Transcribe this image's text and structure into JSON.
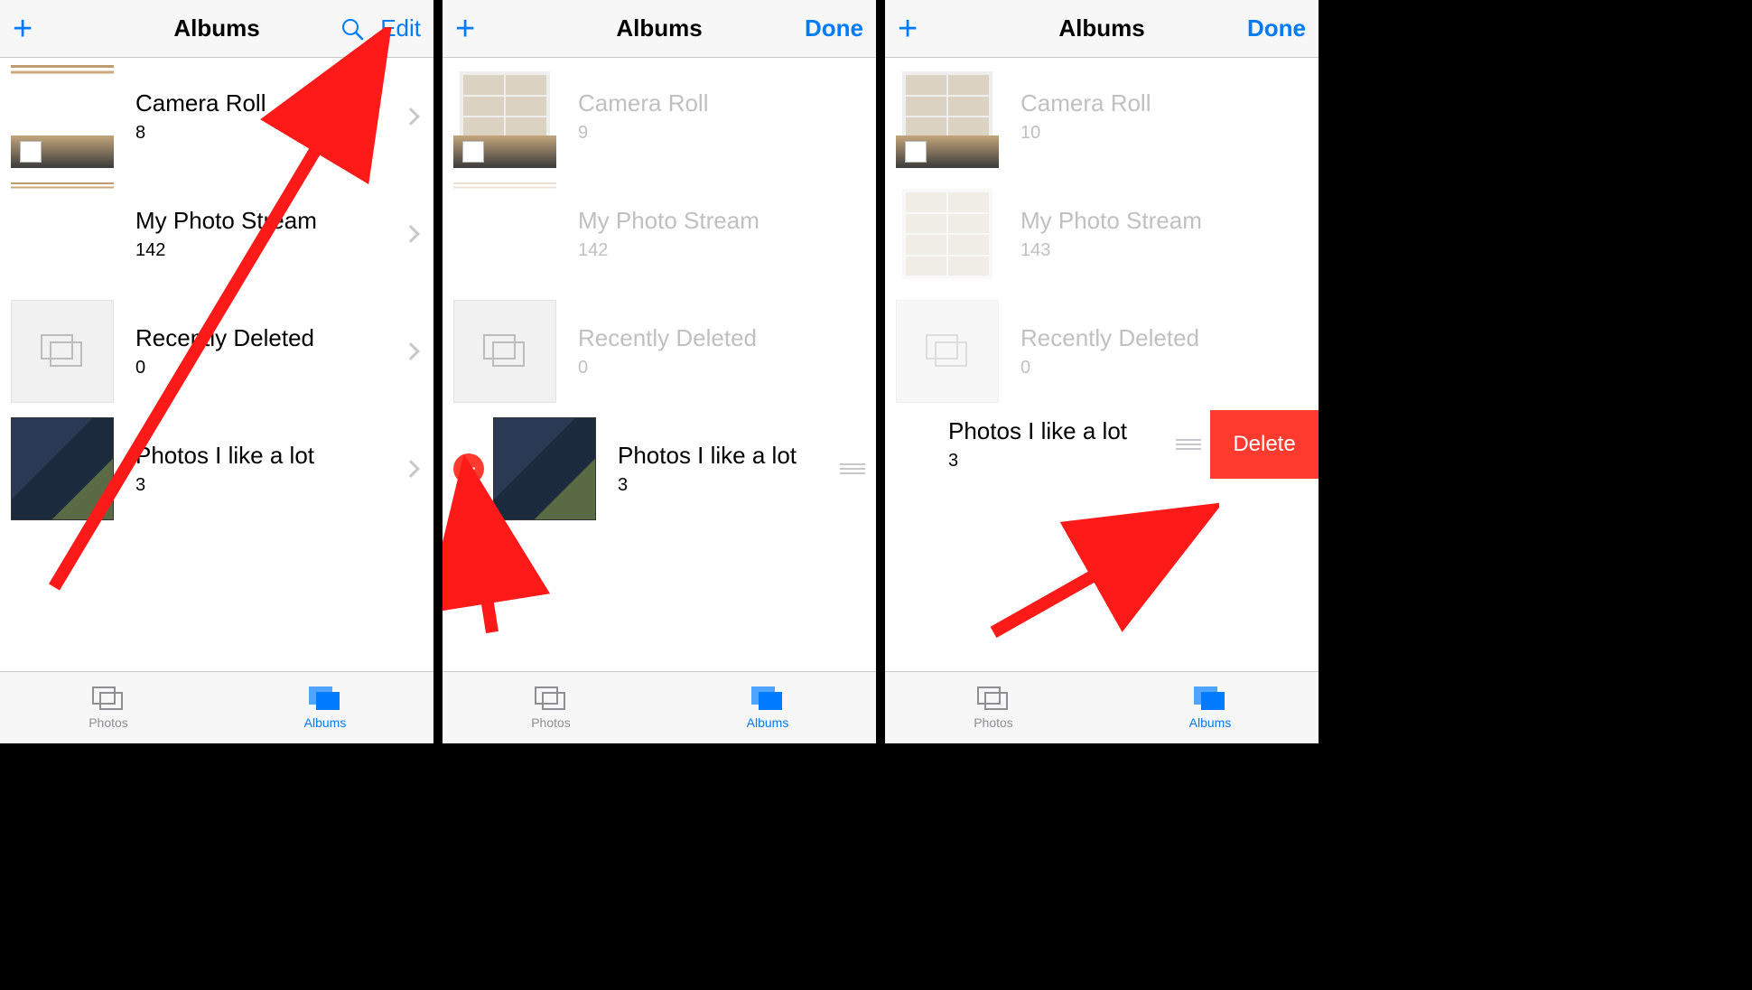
{
  "colors": {
    "tint": "#007aff",
    "destructive": "#ff3b30"
  },
  "tabs": {
    "photos": "Photos",
    "albums": "Albums"
  },
  "buttons": {
    "edit": "Edit",
    "done": "Done",
    "delete": "Delete"
  },
  "screens": [
    {
      "title": "Albums",
      "right_button": "edit",
      "show_search": true,
      "albums": [
        {
          "name": "Camera Roll",
          "count": 8,
          "thumb": "strip",
          "editable": false
        },
        {
          "name": "My Photo Stream",
          "count": 142,
          "thumb": "strip2",
          "editable": false
        },
        {
          "name": "Recently Deleted",
          "count": 0,
          "thumb": "empty",
          "editable": false
        },
        {
          "name": "Photos I like a lot",
          "count": 3,
          "thumb": "photo",
          "editable": true
        }
      ]
    },
    {
      "title": "Albums",
      "right_button": "done",
      "show_search": false,
      "albums": [
        {
          "name": "Camera Roll",
          "count": 9,
          "thumb": "grid",
          "editable": false
        },
        {
          "name": "My Photo Stream",
          "count": 142,
          "thumb": "strip2",
          "editable": false
        },
        {
          "name": "Recently Deleted",
          "count": 0,
          "thumb": "empty",
          "editable": false
        },
        {
          "name": "Photos I like a lot",
          "count": 3,
          "thumb": "photo",
          "editable": true
        }
      ]
    },
    {
      "title": "Albums",
      "right_button": "done",
      "show_search": false,
      "albums": [
        {
          "name": "Camera Roll",
          "count": 10,
          "thumb": "grid",
          "editable": false
        },
        {
          "name": "My Photo Stream",
          "count": 143,
          "thumb": "grid2",
          "editable": false
        },
        {
          "name": "Recently Deleted",
          "count": 0,
          "thumb": "empty",
          "editable": false
        },
        {
          "name": "Photos I like a lot",
          "count": 3,
          "thumb": "photo",
          "editable": true,
          "swiped": true
        }
      ]
    }
  ]
}
